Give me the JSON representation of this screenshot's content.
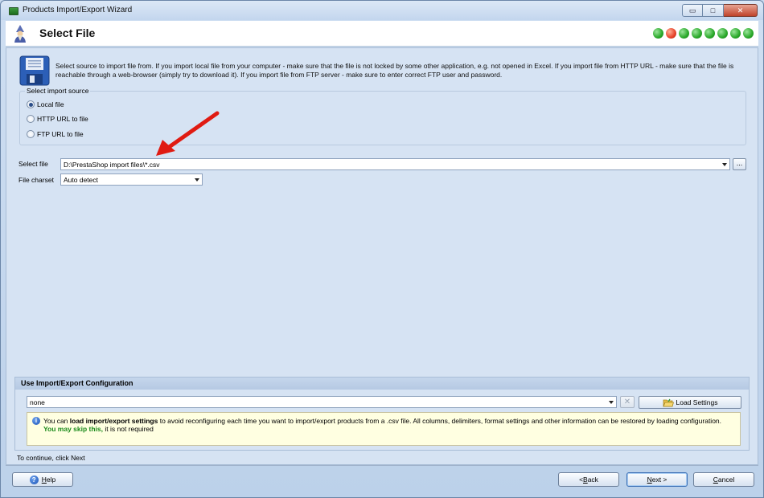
{
  "window": {
    "title": "Products Import/Export Wizard",
    "controls": {
      "minimize": "▭",
      "maximize": "□",
      "close": "✕"
    }
  },
  "header": {
    "title": "Select File",
    "step_indicator": {
      "total": 8,
      "current": 2
    }
  },
  "description": "Select source to import file from. If you import local file from your computer - make sure that the file is not locked by some other application, e.g. not opened in Excel. If you import file from HTTP URL - make sure that the file is reachable through a web-browser (simply try to download it). If you import file from FTP server - make sure to enter correct FTP user and password.",
  "import_source": {
    "legend": "Select import source",
    "options": [
      {
        "label": "Local file",
        "selected": true
      },
      {
        "label": "HTTP URL to file",
        "selected": false
      },
      {
        "label": "FTP URL to file",
        "selected": false
      }
    ]
  },
  "select_file": {
    "label": "Select file",
    "value": "D:\\PrestaShop import files\\*.csv",
    "browse_label": "..."
  },
  "file_charset": {
    "label": "File charset",
    "value": "Auto detect"
  },
  "configuration": {
    "header": "Use Import/Export Configuration",
    "value": "none",
    "clear_label": "✕",
    "load_button": "Load Settings",
    "info": {
      "prefix": "You can ",
      "bold": "load import/export settings",
      "middle": " to avoid reconfiguring each time you want to import/export products from a .csv file. All columns, delimiters, format settings and other information can be restored by loading configuration. ",
      "green": "You may skip this,",
      "suffix": " it is not required"
    }
  },
  "status": "To continue, click Next",
  "footer": {
    "help": {
      "underlined": "H",
      "rest": "elp"
    },
    "back": {
      "prefix": "< ",
      "underlined": "B",
      "rest": "ack"
    },
    "next": {
      "underlined": "N",
      "rest": "ext >"
    },
    "cancel": {
      "underlined": "C",
      "rest": "ancel"
    }
  },
  "colors": {
    "active_step": "#e6432a",
    "step": "#29a829",
    "annotation_arrow": "#e01b12",
    "skip_text": "#1a8a1a"
  }
}
